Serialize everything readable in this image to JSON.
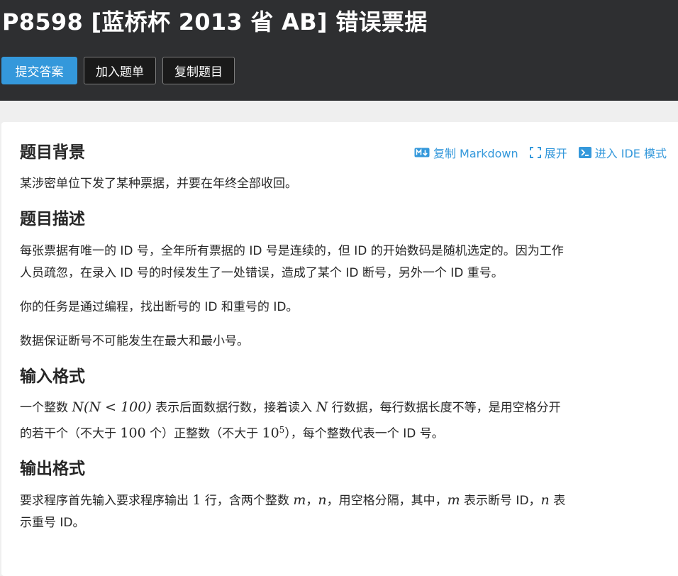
{
  "header": {
    "title": "P8598 [蓝桥杯 2013 省 AB] 错误票据",
    "buttons": {
      "submit": "提交答案",
      "add_list": "加入题单",
      "copy": "复制题目"
    }
  },
  "tools": {
    "copy_markdown": "复制 Markdown",
    "expand": "展开",
    "ide": "进入 IDE 模式"
  },
  "sections": {
    "background": {
      "title": "题目背景",
      "text": "某涉密单位下发了某种票据，并要在年终全部收回。"
    },
    "description": {
      "title": "题目描述",
      "p1_line1": "每张票据有唯一的 ID 号，全年所有票据的 ID 号是连续的，但 ID 的开始数码是随机选定的。因为工作",
      "p1_line2": "人员疏忽，在录入 ID 号的时候发生了一处错误，造成了某个 ID 断号，另外一个 ID 重号。",
      "p2": "你的任务是通过编程，找出断号的 ID 和重号的 ID。",
      "p3": "数据保证断号不可能发生在最大和最小号。"
    },
    "input": {
      "title": "输入格式",
      "l1_a": "一个整数 ",
      "l1_math1": "N(N < 100)",
      "l1_b": " 表示后面数据行数，接着读入 ",
      "l1_math2": "N",
      "l1_c": " 行数据，每行数据长度不等，是用空格分开",
      "l2_a": "的若干个（不大于 ",
      "l2_num": "100",
      "l2_b": " 个）正整数（不大于 ",
      "l2_base": "10",
      "l2_exp": "5",
      "l2_c": "），每个整数代表一个 ID 号。"
    },
    "output": {
      "title": "输出格式",
      "l1_a": "要求程序首先输入要求程序输出 ",
      "l1_num": "1",
      "l1_b": " 行，含两个整数 ",
      "l1_m": "m",
      "l1_c": "，",
      "l1_n": "n",
      "l1_d": "，用空格分隔，其中，",
      "l1_m2": "m",
      "l1_e": " 表示断号 ID，",
      "l1_n2": "n",
      "l1_f": " 表",
      "l2": "示重号 ID。"
    }
  },
  "colors": {
    "header_bg": "#2e2f31",
    "primary": "#3498db",
    "page_bg": "#efefef"
  }
}
